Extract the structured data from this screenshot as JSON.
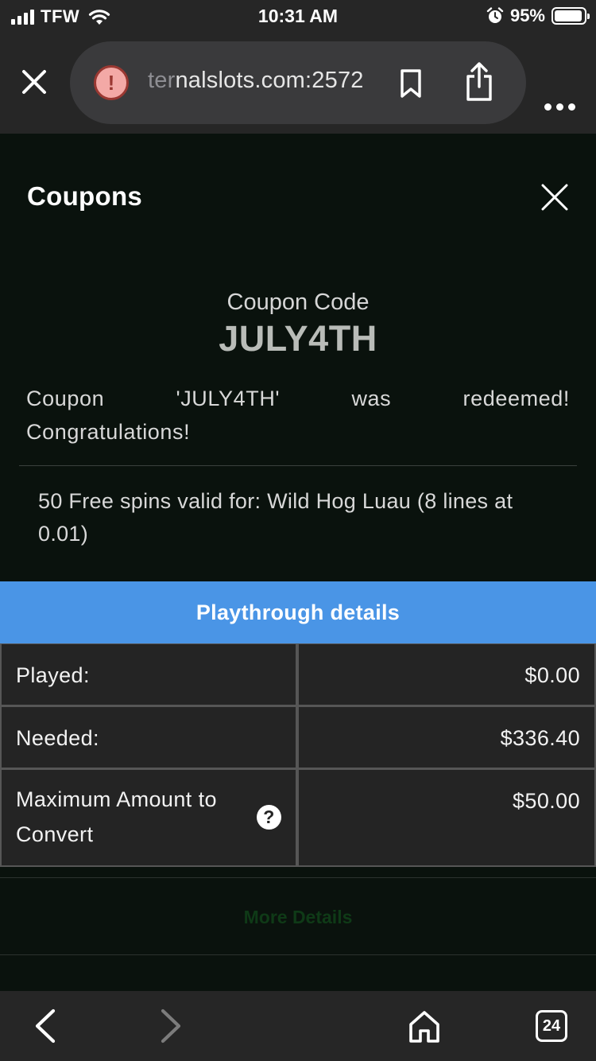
{
  "status_bar": {
    "carrier": "TFW",
    "time": "10:31 AM",
    "battery_percent": "95%",
    "battery_level": 0.95,
    "icons": [
      "signal-icon",
      "wifi-icon",
      "alarm-icon",
      "battery-icon"
    ]
  },
  "browser": {
    "url_dim": "ter",
    "url_main": "nalslots.com:2572",
    "warning_glyph": "!",
    "icons": [
      "close-icon",
      "warning-icon",
      "bookmark-icon",
      "share-icon",
      "more-icon"
    ]
  },
  "modal": {
    "title": "Coupons",
    "coupon_label": "Coupon Code",
    "coupon_code": "JULY4TH",
    "message_words": [
      "Coupon",
      "'JULY4TH'",
      "was",
      "redeemed!"
    ],
    "message_line2": "Congratulations!",
    "spins_text": "50 Free spins valid for: Wild Hog Luau (8 lines at 0.01)"
  },
  "playthrough": {
    "header": "Playthrough details",
    "rows": [
      {
        "label": "Played:",
        "value": "$0.00"
      },
      {
        "label": "Needed:",
        "value": "$336.40"
      },
      {
        "label": "Maximum Amount to Convert",
        "value": "$50.00",
        "help": "?"
      }
    ]
  },
  "more_details": "More Details",
  "toolbar": {
    "tabs_count": "24",
    "icons": [
      "back-icon",
      "forward-icon",
      "home-icon",
      "tabs-icon"
    ]
  },
  "colors": {
    "accent": "#4a95e6",
    "bar_bg": "#262626",
    "page_bg": "#0a120d"
  }
}
